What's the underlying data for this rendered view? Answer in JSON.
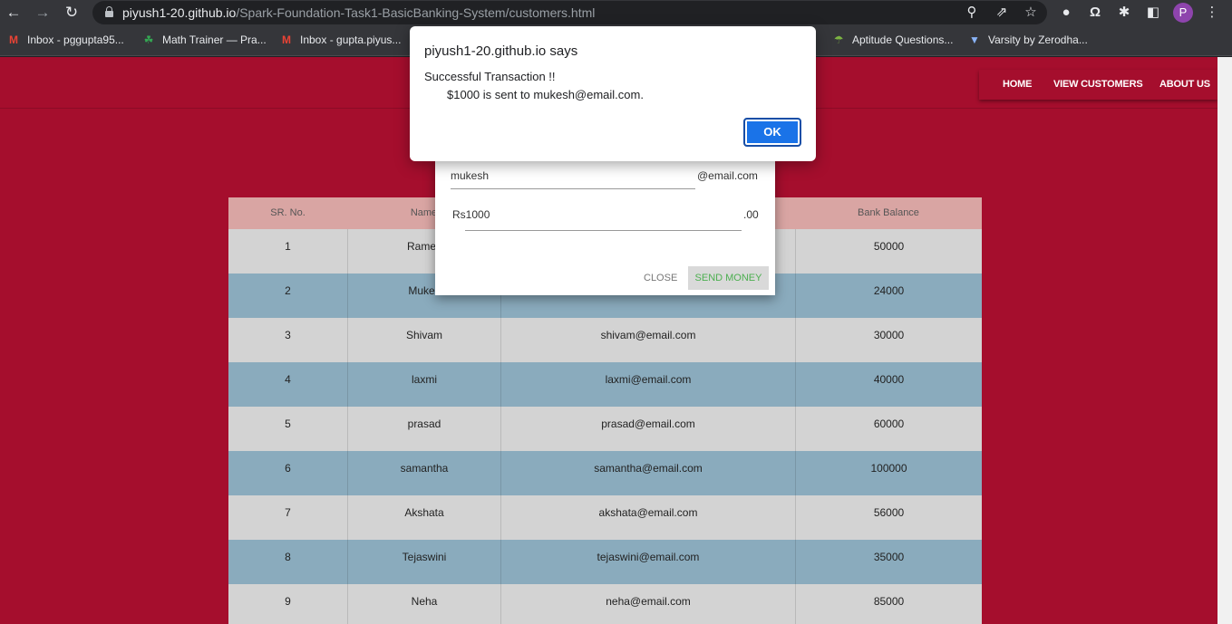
{
  "browser": {
    "url_host": "piyush1-20.github.io",
    "url_path": "/Spark-Foundation-Task1-BasicBanking-System/customers.html",
    "profile_initial": "P",
    "bookmarks": [
      {
        "label": "Inbox - pggupta95...",
        "icon": "gmail-icon"
      },
      {
        "label": "Math Trainer — Pra...",
        "icon": "math-trainer-icon"
      },
      {
        "label": "Inbox - gupta.piyus...",
        "icon": "gmail-icon"
      },
      {
        "label": "Aptitude Questions...",
        "icon": "indiabix-icon"
      },
      {
        "label": "Varsity by Zerodha...",
        "icon": "shield-icon"
      }
    ]
  },
  "nav": {
    "home": "HOME",
    "view_customers": "VIEW CUSTOMERS",
    "about_us": "ABOUT US"
  },
  "table": {
    "headers": [
      "SR. No.",
      "Name",
      "",
      "Bank Balance"
    ],
    "rows": [
      {
        "sr": "1",
        "name": "Rames",
        "email": "",
        "balance": "50000"
      },
      {
        "sr": "2",
        "name": "Mukes",
        "email": "",
        "balance": "24000"
      },
      {
        "sr": "3",
        "name": "Shivam",
        "email": "shivam@email.com",
        "balance": "30000"
      },
      {
        "sr": "4",
        "name": "laxmi",
        "email": "laxmi@email.com",
        "balance": "40000"
      },
      {
        "sr": "5",
        "name": "prasad",
        "email": "prasad@email.com",
        "balance": "60000"
      },
      {
        "sr": "6",
        "name": "samantha",
        "email": "samantha@email.com",
        "balance": "100000"
      },
      {
        "sr": "7",
        "name": "Akshata",
        "email": "akshata@email.com",
        "balance": "56000"
      },
      {
        "sr": "8",
        "name": "Tejaswini",
        "email": "tejaswini@email.com",
        "balance": "35000"
      },
      {
        "sr": "9",
        "name": "Neha",
        "email": "neha@email.com",
        "balance": "85000"
      }
    ]
  },
  "modal": {
    "recipient_value": "mukesh",
    "recipient_suffix": "@email.com",
    "amount_value": "Rs1000",
    "amount_suffix": ".00",
    "close_label": "CLOSE",
    "send_label": "SEND MONEY"
  },
  "alert": {
    "title": "piyush1-20.github.io says",
    "line1": "Successful Transaction !!",
    "line2": "$1000 is sent to mukesh@email.com.",
    "ok_label": "OK"
  },
  "colors": {
    "page_bg": "#a50e2d",
    "row_light": "#d3d3d3",
    "row_blue": "#8aabbd",
    "header_bg": "#d9a5a3",
    "ok_button": "#1a73e8",
    "send_text": "#4caf50"
  }
}
